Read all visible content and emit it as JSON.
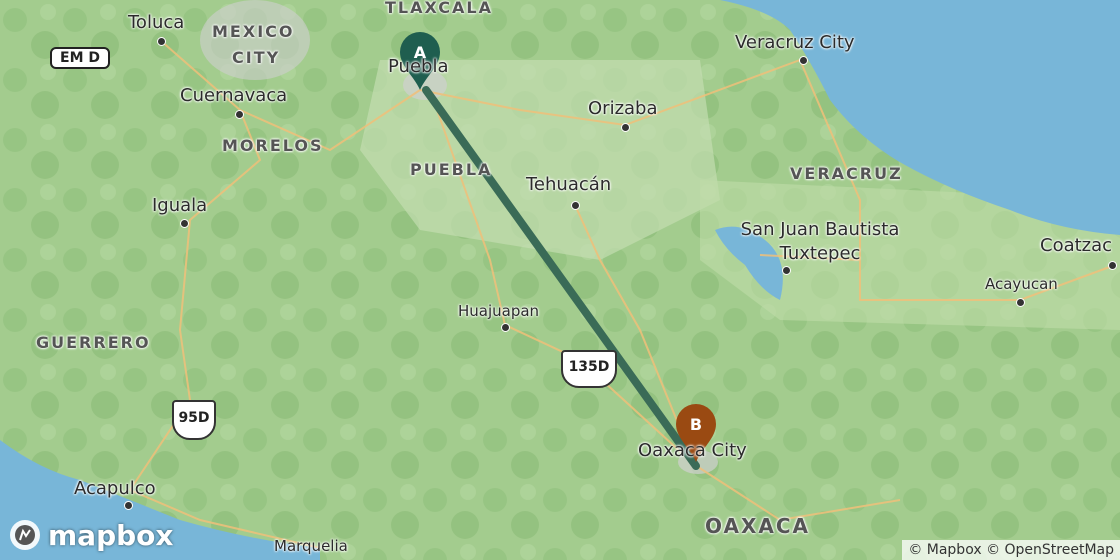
{
  "map": {
    "provider_logo": "mapbox",
    "attribution": "© Mapbox © OpenStreetMap",
    "route_color": "#3a6b57",
    "marker_a_color": "#1f5e4f",
    "marker_b_color": "#9a4a12",
    "water_color": "#78b6d8"
  },
  "markers": {
    "a": {
      "label": "A",
      "city": "Puebla"
    },
    "b": {
      "label": "B",
      "city": "Oaxaca City"
    }
  },
  "cities": [
    {
      "name": "Toluca"
    },
    {
      "name": "Cuernavaca"
    },
    {
      "name": "Iguala"
    },
    {
      "name": "Acapulco"
    },
    {
      "name": "Marquelia"
    },
    {
      "name": "Orizaba"
    },
    {
      "name": "Veracruz City"
    },
    {
      "name": "Tehuacán"
    },
    {
      "name": "San Juan Bautista Tuxtepec"
    },
    {
      "name": "Huajuapan"
    },
    {
      "name": "Acayucan"
    },
    {
      "name": "Coatzac"
    }
  ],
  "regions": [
    {
      "name": "TLAXCALA"
    },
    {
      "name": "MEXICO"
    },
    {
      "name": "CITY"
    },
    {
      "name": "MORELOS"
    },
    {
      "name": "PUEBLA"
    },
    {
      "name": "VERACRUZ"
    },
    {
      "name": "GUERRERO"
    },
    {
      "name": "OAXACA"
    }
  ],
  "shields": [
    {
      "label": "EM D"
    },
    {
      "label": "95D"
    },
    {
      "label": "135D"
    }
  ]
}
